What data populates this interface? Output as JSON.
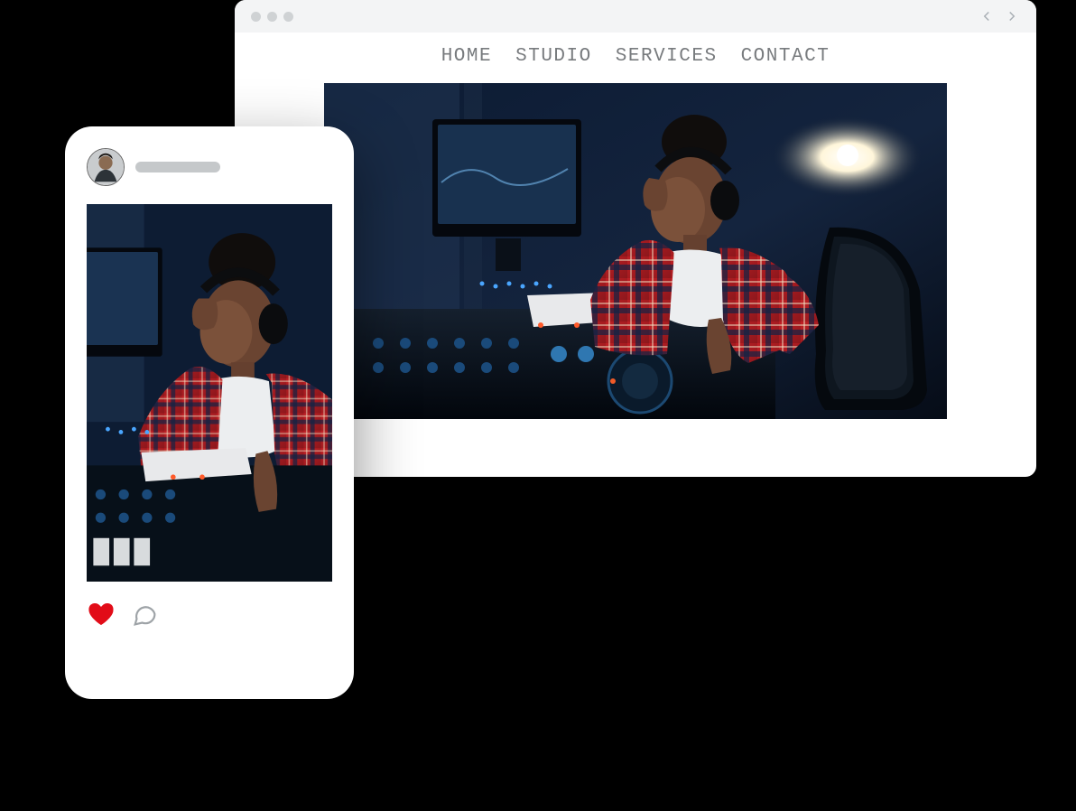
{
  "browser": {
    "nav": {
      "items": [
        "HOME",
        "STUDIO",
        "SERVICES",
        "CONTACT"
      ]
    }
  },
  "social": {
    "liked": true
  }
}
